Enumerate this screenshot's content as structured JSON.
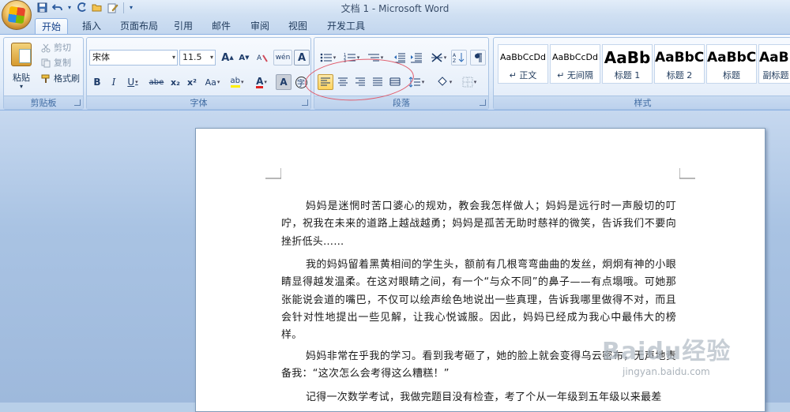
{
  "window": {
    "title": "文档 1 - Microsoft Word"
  },
  "qat": {
    "save_icon": "save-icon",
    "undo_icon": "undo-icon",
    "redo_icon": "redo-icon",
    "dd": "▾"
  },
  "tabs": [
    "开始",
    "插入",
    "页面布局",
    "引用",
    "邮件",
    "审阅",
    "视图",
    "开发工具"
  ],
  "clipboard": {
    "paste": "粘贴",
    "cut": "剪切",
    "copy": "复制",
    "format_painter": "格式刷",
    "group_title": "剪贴板"
  },
  "font": {
    "family": "宋体",
    "size": "11.5",
    "group_title": "字体",
    "bold": "B",
    "italic": "I",
    "underline": "U",
    "strike": "abe",
    "sub": "x₂",
    "sup": "x²",
    "case": "Aa",
    "grow": "A",
    "shrink": "A",
    "wen": "wén",
    "charA": "A",
    "highlight": "ab",
    "color": "A",
    "shade": "A",
    "enclose": "字"
  },
  "paragraph": {
    "group_title": "段落"
  },
  "styles": {
    "group_title": "样式",
    "items": [
      {
        "preview": "AaBbCcDd",
        "name": "↵ 正文"
      },
      {
        "preview": "AaBbCcDd",
        "name": "↵ 无间隔"
      },
      {
        "preview": "AaBb",
        "name": "标题 1"
      },
      {
        "preview": "AaBbC",
        "name": "标题 2"
      },
      {
        "preview": "AaBbC",
        "name": "标题"
      },
      {
        "preview": "AaBl",
        "name": "副标题"
      }
    ]
  },
  "document": {
    "paragraphs": [
      "妈妈是迷惘时苦口婆心的规劝，教会我怎样做人；妈妈是远行时一声殷切的叮咛，祝我在未来的道路上越战越勇；妈妈是孤苦无助时慈祥的微笑，告诉我们不要向挫折低头……",
      "我的妈妈留着黑黄相间的学生头，额前有几根弯弯曲曲的发丝，炯炯有神的小眼睛显得越发温柔。在这对眼睛之间，有一个“与众不同”的鼻子——有点塌哦。可她那张能说会道的嘴巴，不仅可以绘声绘色地说出一些真理，告诉我哪里做得不对，而且会针对性地提出一些见解，让我心悦诚服。因此，妈妈已经成为我心中最伟大的榜样。",
      "妈妈非常在乎我的学习。看到我考砸了，她的脸上就会变得乌云密布，无声地责备我：“这次怎么会考得这么糟糕！”",
      "记得一次数学考试，我做完题目没有检查，考了个从一年级到五年级以来最差"
    ]
  },
  "watermark": {
    "brand": "Baidu经验",
    "url": "jingyan.baidu.com"
  }
}
